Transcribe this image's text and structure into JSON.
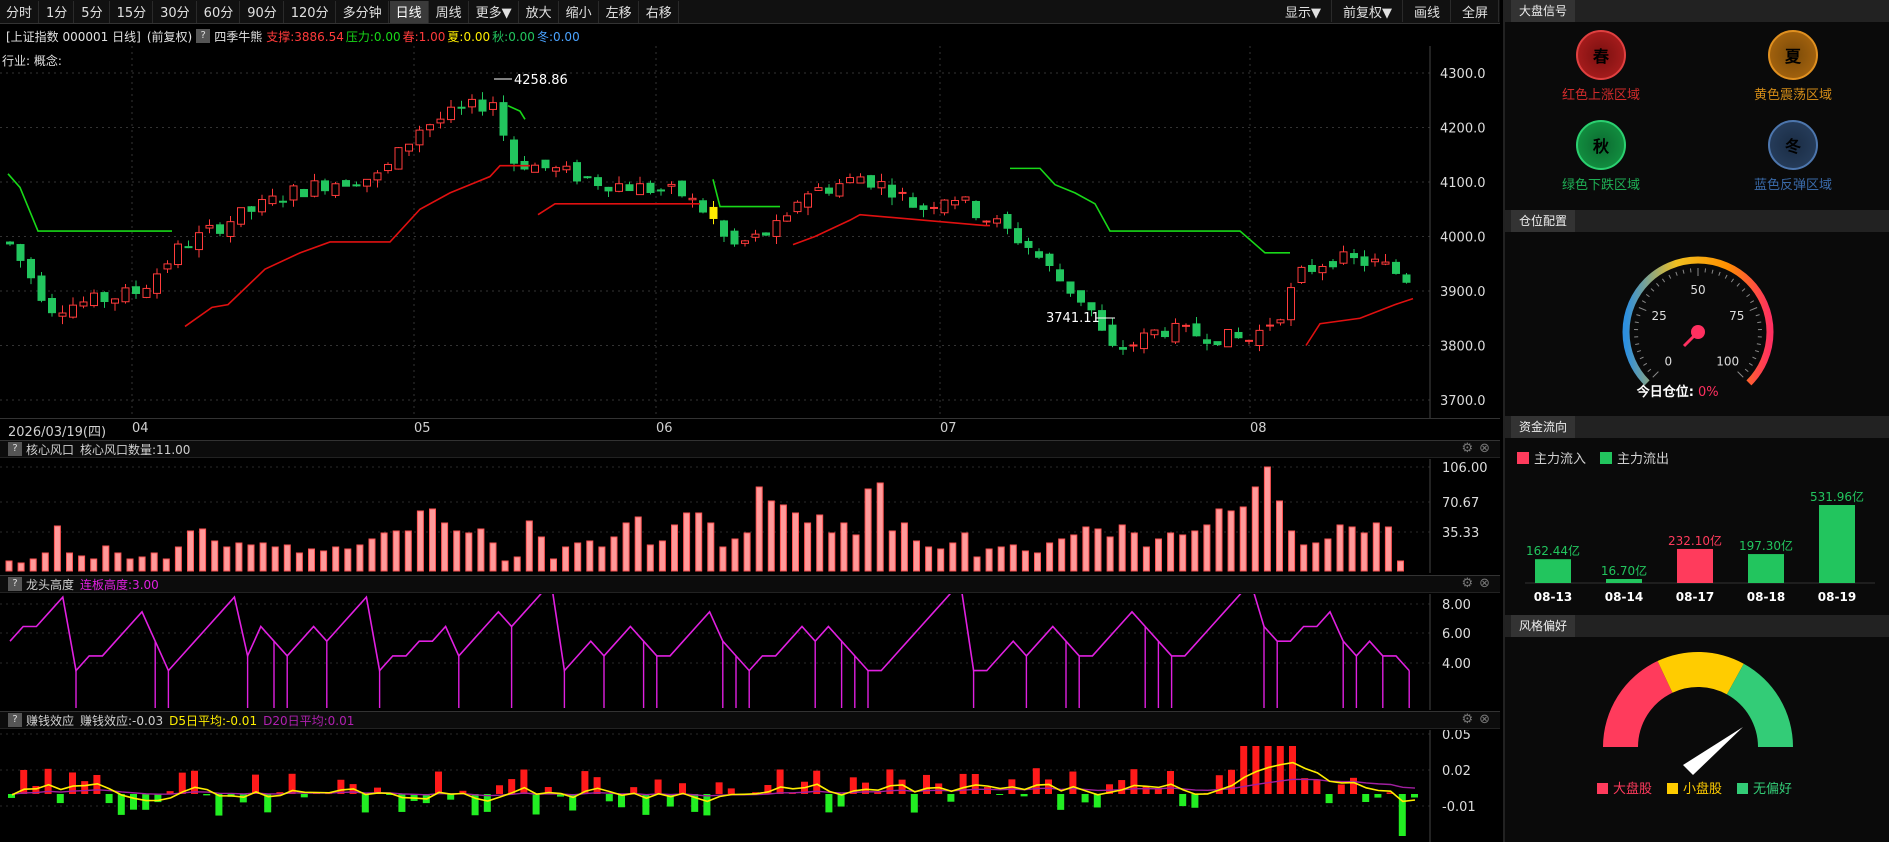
{
  "toolbar": {
    "left": [
      "分时",
      "1分",
      "5分",
      "15分",
      "30分",
      "60分",
      "90分",
      "120分",
      "多分钟",
      "日线",
      "周线",
      "更多▼",
      "放大",
      "缩小",
      "左移",
      "右移"
    ],
    "active": "日线",
    "right": [
      "显示▼",
      "前复权▼",
      "画线",
      "全屏"
    ]
  },
  "info": {
    "index": "[上证指数 000001 日线]",
    "adj": "(前复权)",
    "indicator": "四季牛熊",
    "support": "支撑:3886.54",
    "pressure": "压力:0.00",
    "spring": "春:1.00",
    "summer": "夏:0.00",
    "autumn": "秋:0.00",
    "winter": "冬:0.00",
    "sub": "行业: 概念:"
  },
  "colors": {
    "up": "#ff3b3b",
    "down": "#22c55e",
    "pressure": "#18d818",
    "support": "#e01010",
    "yellow": "#ffee00",
    "magenta": "#e020e0",
    "grid": "#333333"
  },
  "price_axis": {
    "ticks": [
      "4300.0",
      "4200.0",
      "4100.0",
      "4000.0",
      "3900.0",
      "3800.0",
      "3700.0"
    ],
    "high": "4258.86",
    "low": "3741.11"
  },
  "date_axis": {
    "labels": [
      "2026/03/19(四)",
      "04",
      "05",
      "06",
      "07",
      "08"
    ]
  },
  "pane1": {
    "name": "核心风口",
    "value": "核心风口数量:11.00",
    "ticks": [
      "106.00",
      "70.67",
      "35.33"
    ]
  },
  "pane2": {
    "name": "龙头高度",
    "value": "连板高度:3.00",
    "ticks": [
      "8.00",
      "6.00",
      "4.00"
    ]
  },
  "pane3": {
    "name": "赚钱效应",
    "value": "赚钱效应:-0.03",
    "d5": "D5日平均:-0.01",
    "d20": "D20日平均:0.01",
    "ticks": [
      "0.05",
      "0.02",
      "-0.01"
    ]
  },
  "right": {
    "signal_title": "大盘信号",
    "signals": [
      {
        "glyph": "春",
        "label": "红色上涨区域",
        "color": "#d12b2b"
      },
      {
        "glyph": "夏",
        "label": "黄色震荡区域",
        "color": "#d08a18"
      },
      {
        "glyph": "秋",
        "label": "绿色下跌区域",
        "color": "#1fae55"
      },
      {
        "glyph": "冬",
        "label": "蓝色反弹区域",
        "color": "#3a6aa8"
      }
    ],
    "position_title": "仓位配置",
    "gauge_ticks": [
      "0",
      "25",
      "50",
      "75",
      "100"
    ],
    "position_label": "今日仓位:",
    "position_value": "0%",
    "flow_title": "资金流向",
    "flow_in": "主力流入",
    "flow_out": "主力流出",
    "flow": [
      {
        "date": "08-13",
        "value": "162.44亿",
        "v": 162.44,
        "dir": "out"
      },
      {
        "date": "08-14",
        "value": "16.70亿",
        "v": 16.7,
        "dir": "out"
      },
      {
        "date": "08-17",
        "value": "232.10亿",
        "v": 232.1,
        "dir": "in"
      },
      {
        "date": "08-18",
        "value": "197.30亿",
        "v": 197.3,
        "dir": "out"
      },
      {
        "date": "08-19",
        "value": "531.96亿",
        "v": 531.96,
        "dir": "out"
      }
    ],
    "style_title": "风格偏好",
    "style_legend": [
      {
        "label": "大盘股",
        "color": "#ff3b5c"
      },
      {
        "label": "小盘股",
        "color": "#ffcc00"
      },
      {
        "label": "无偏好",
        "color": "#33cc77"
      }
    ]
  }
}
